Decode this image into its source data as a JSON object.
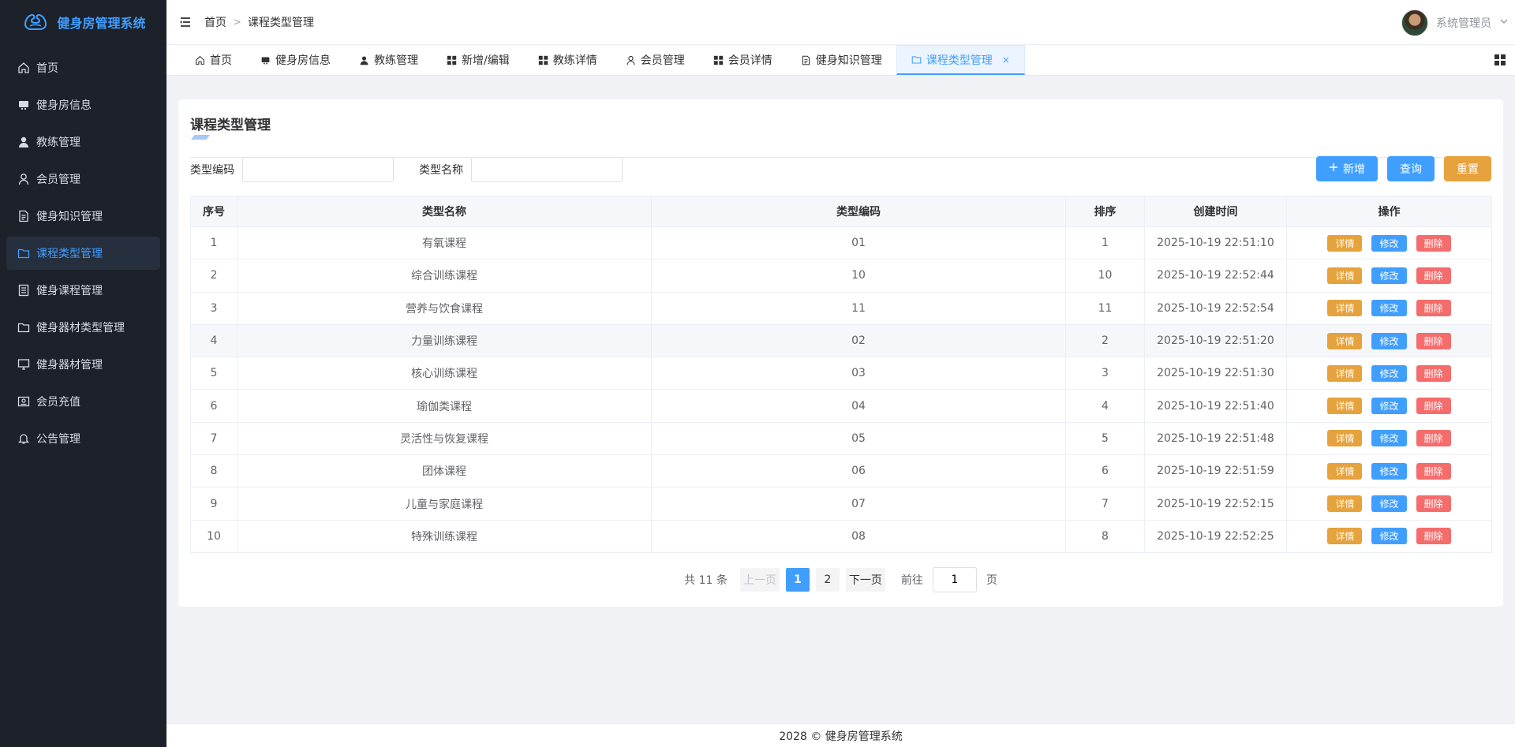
{
  "app": {
    "title": "健身房管理系统",
    "accent": "#409eff",
    "sidebar_bg": "#1d2129"
  },
  "sidebar": {
    "items": [
      {
        "label": "首页",
        "icon": "home-icon",
        "active": false
      },
      {
        "label": "健身房信息",
        "icon": "building-icon",
        "active": false
      },
      {
        "label": "教练管理",
        "icon": "user-fill-icon",
        "active": false
      },
      {
        "label": "会员管理",
        "icon": "user-outline-icon",
        "active": false
      },
      {
        "label": "健身知识管理",
        "icon": "document-icon",
        "active": false
      },
      {
        "label": "课程类型管理",
        "icon": "folder-icon",
        "active": true
      },
      {
        "label": "健身课程管理",
        "icon": "list-doc-icon",
        "active": false
      },
      {
        "label": "健身器材类型管理",
        "icon": "folder-icon",
        "active": false
      },
      {
        "label": "健身器材管理",
        "icon": "monitor-icon",
        "active": false
      },
      {
        "label": "会员充值",
        "icon": "wallet-icon",
        "active": false
      },
      {
        "label": "公告管理",
        "icon": "bell-icon",
        "active": false
      }
    ]
  },
  "header": {
    "breadcrumb": [
      "首页",
      "课程类型管理"
    ],
    "user_name": "系统管理员"
  },
  "tabs": [
    {
      "label": "首页",
      "icon": "home-icon",
      "active": false
    },
    {
      "label": "健身房信息",
      "icon": "building-icon",
      "active": false
    },
    {
      "label": "教练管理",
      "icon": "user-fill-icon",
      "active": false
    },
    {
      "label": "新增/编辑",
      "icon": "grid-icon",
      "active": false
    },
    {
      "label": "教练详情",
      "icon": "grid-icon",
      "active": false
    },
    {
      "label": "会员管理",
      "icon": "user-outline-icon",
      "active": false
    },
    {
      "label": "会员详情",
      "icon": "grid-icon",
      "active": false
    },
    {
      "label": "健身知识管理",
      "icon": "document-icon",
      "active": false
    },
    {
      "label": "课程类型管理",
      "icon": "folder-icon",
      "active": true
    }
  ],
  "page": {
    "title": "课程类型管理",
    "filters": {
      "code_label": "类型编码",
      "code_value": "",
      "name_label": "类型名称",
      "name_value": ""
    },
    "buttons": {
      "add": "新增",
      "search": "查询",
      "reset": "重置"
    }
  },
  "table": {
    "columns": [
      "序号",
      "类型名称",
      "类型编码",
      "排序",
      "创建时间",
      "操作"
    ],
    "row_actions": {
      "detail": "详情",
      "edit": "修改",
      "delete": "删除"
    },
    "rows": [
      {
        "index": "1",
        "name": "有氧课程",
        "code": "01",
        "sort": "1",
        "created": "2025-10-19 22:51:10",
        "highlight": false
      },
      {
        "index": "2",
        "name": "综合训练课程",
        "code": "10",
        "sort": "10",
        "created": "2025-10-19 22:52:44",
        "highlight": false
      },
      {
        "index": "3",
        "name": "营养与饮食课程",
        "code": "11",
        "sort": "11",
        "created": "2025-10-19 22:52:54",
        "highlight": false
      },
      {
        "index": "4",
        "name": "力量训练课程",
        "code": "02",
        "sort": "2",
        "created": "2025-10-19 22:51:20",
        "highlight": true
      },
      {
        "index": "5",
        "name": "核心训练课程",
        "code": "03",
        "sort": "3",
        "created": "2025-10-19 22:51:30",
        "highlight": false
      },
      {
        "index": "6",
        "name": "瑜伽类课程",
        "code": "04",
        "sort": "4",
        "created": "2025-10-19 22:51:40",
        "highlight": false
      },
      {
        "index": "7",
        "name": "灵活性与恢复课程",
        "code": "05",
        "sort": "5",
        "created": "2025-10-19 22:51:48",
        "highlight": false
      },
      {
        "index": "8",
        "name": "团体课程",
        "code": "06",
        "sort": "6",
        "created": "2025-10-19 22:51:59",
        "highlight": false
      },
      {
        "index": "9",
        "name": "儿童与家庭课程",
        "code": "07",
        "sort": "7",
        "created": "2025-10-19 22:52:15",
        "highlight": false
      },
      {
        "index": "10",
        "name": "特殊训练课程",
        "code": "08",
        "sort": "8",
        "created": "2025-10-19 22:52:25",
        "highlight": false
      }
    ]
  },
  "pagination": {
    "total_text": "共 11 条",
    "prev": "上一页",
    "pages": [
      "1",
      "2"
    ],
    "current": "1",
    "next": "下一页",
    "goto_label": "前往",
    "goto_value": "1",
    "page_suffix": "页"
  },
  "footer": {
    "text": "2028 © 健身房管理系统"
  }
}
